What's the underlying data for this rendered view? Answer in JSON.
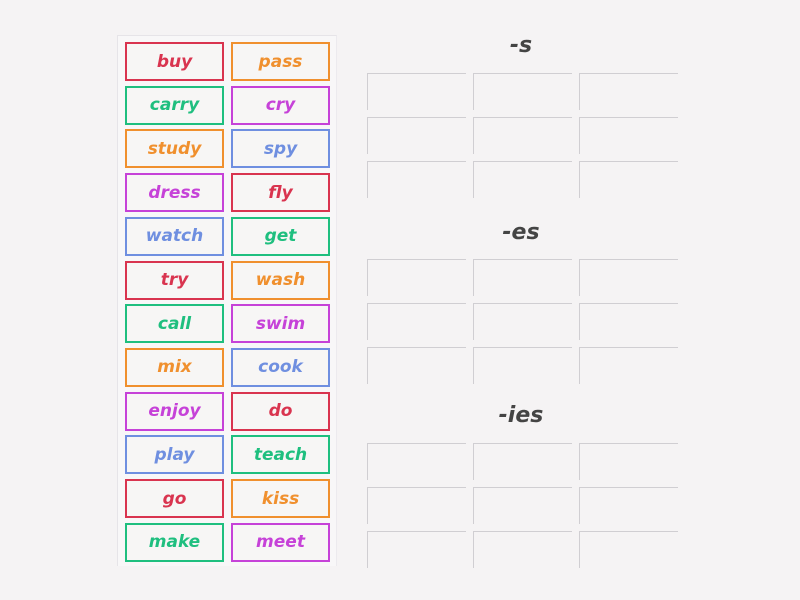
{
  "colors": {
    "red": "#d9344f",
    "orange": "#f0902e",
    "green": "#1fbf7f",
    "purple": "#c642d8",
    "blue": "#6f8fe0"
  },
  "tiles": [
    {
      "word": "buy",
      "color": "red"
    },
    {
      "word": "pass",
      "color": "orange"
    },
    {
      "word": "carry",
      "color": "green"
    },
    {
      "word": "cry",
      "color": "purple"
    },
    {
      "word": "study",
      "color": "orange"
    },
    {
      "word": "spy",
      "color": "blue"
    },
    {
      "word": "dress",
      "color": "purple"
    },
    {
      "word": "fly",
      "color": "red"
    },
    {
      "word": "watch",
      "color": "blue"
    },
    {
      "word": "get",
      "color": "green"
    },
    {
      "word": "try",
      "color": "red"
    },
    {
      "word": "wash",
      "color": "orange"
    },
    {
      "word": "call",
      "color": "green"
    },
    {
      "word": "swim",
      "color": "purple"
    },
    {
      "word": "mix",
      "color": "orange"
    },
    {
      "word": "cook",
      "color": "blue"
    },
    {
      "word": "enjoy",
      "color": "purple"
    },
    {
      "word": "do",
      "color": "red"
    },
    {
      "word": "play",
      "color": "blue"
    },
    {
      "word": "teach",
      "color": "green"
    },
    {
      "word": "go",
      "color": "red"
    },
    {
      "word": "kiss",
      "color": "orange"
    },
    {
      "word": "make",
      "color": "green"
    },
    {
      "word": "meet",
      "color": "purple"
    }
  ],
  "groups": [
    {
      "title": "-s"
    },
    {
      "title": "-es"
    },
    {
      "title": "-ies"
    }
  ]
}
